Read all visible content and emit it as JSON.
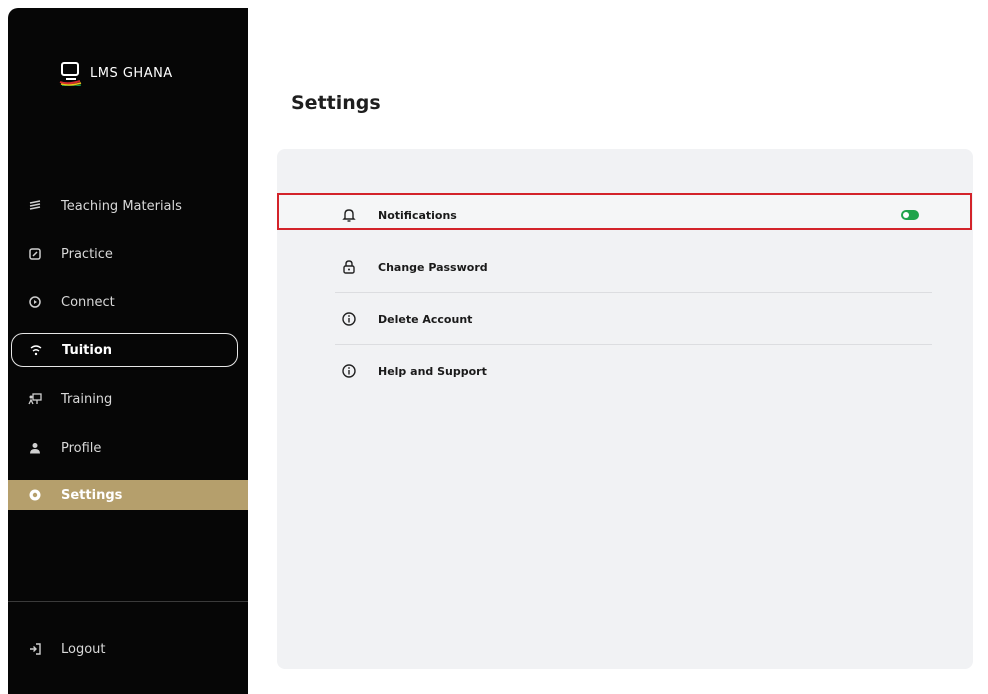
{
  "brand": {
    "name": "LMS GHANA"
  },
  "sidebar": {
    "items": [
      {
        "label": "Teaching Materials",
        "icon": "layers-icon"
      },
      {
        "label": "Practice",
        "icon": "edit-icon"
      },
      {
        "label": "Connect",
        "icon": "chat-icon"
      },
      {
        "label": "Tuition",
        "icon": "wifi-icon",
        "state": "outlined"
      },
      {
        "label": "Training",
        "icon": "presentation-icon"
      },
      {
        "label": "Profile",
        "icon": "user-icon"
      },
      {
        "label": "Settings",
        "icon": "gear-icon",
        "state": "active"
      }
    ],
    "logout": {
      "label": "Logout",
      "icon": "logout-icon"
    }
  },
  "main": {
    "title": "Settings",
    "settings": [
      {
        "label": "Notifications",
        "icon": "bell-icon",
        "toggle": "on",
        "highlighted": true
      },
      {
        "label": "Change Password",
        "icon": "lock-icon"
      },
      {
        "label": "Delete Account",
        "icon": "info-icon"
      },
      {
        "label": "Help and Support",
        "icon": "info-icon"
      }
    ]
  },
  "colors": {
    "sidebar_bg": "#060606",
    "active_bg": "#b59f6c",
    "highlight_border": "#d3232a",
    "toggle_on": "#1fa34b"
  }
}
